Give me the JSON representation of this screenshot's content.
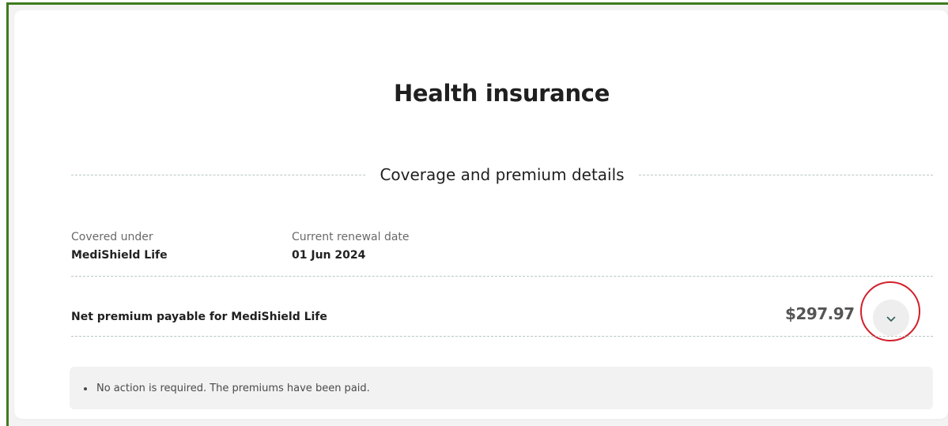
{
  "page": {
    "title": "Health insurance"
  },
  "section": {
    "heading": "Coverage and premium details"
  },
  "coverage": {
    "covered_under_label": "Covered under",
    "covered_under_value": "MediShield Life",
    "renewal_label": "Current renewal date",
    "renewal_value": "01 Jun 2024"
  },
  "premium": {
    "label": "Net premium payable for MediShield Life",
    "amount": "$297.97",
    "expand_icon": "chevron-down-icon"
  },
  "notice": {
    "items": [
      "No action is required. The premiums have been paid."
    ]
  },
  "colors": {
    "frame_accent": "#3f7a1f",
    "highlight_ring": "#d21f2b",
    "divider": "#b9c8c2",
    "chevron": "#2e5f56"
  }
}
